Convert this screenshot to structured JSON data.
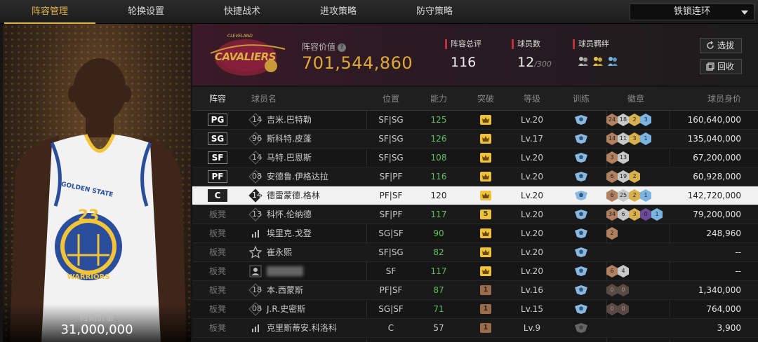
{
  "tabs": [
    "阵容管理",
    "轮换设置",
    "快捷战术",
    "进攻策略",
    "防守策略"
  ],
  "active_tab": 0,
  "dropdown": {
    "selected": "铁锁连环"
  },
  "player_panel": {
    "value_label": "时刻价值",
    "value": "31,000,000",
    "jersey_team": "GOLDEN STATE",
    "jersey_number": "23",
    "jersey_bottom": "WARRIORS"
  },
  "team": {
    "logo_text": "CAVALIERS",
    "logo_small": "CLEVELAND",
    "lineup_label": "阵容价值",
    "lineup_value": "701,544,860",
    "total_label": "阵容总评",
    "total_value": "116",
    "players_label": "球员数",
    "players_value": "12",
    "players_max": "/300",
    "bond_label": "球员羁绊"
  },
  "buttons": {
    "select": "选拔",
    "recycle": "回收"
  },
  "columns": [
    "阵容",
    "球员名",
    "位置",
    "能力",
    "突破",
    "等级",
    "训练",
    "徽章",
    "球员身价"
  ],
  "rows": [
    {
      "slot": "PG",
      "num": "14",
      "name": "吉米.巴特勒",
      "pos": "SF|SG",
      "ability": "125",
      "green": true,
      "brk": "",
      "brk_style": "gold",
      "lv": "Lv.20",
      "badges": [
        [
          "24",
          "bronze"
        ],
        [
          "18",
          "silver"
        ],
        [
          "2",
          "gold"
        ],
        [
          "3",
          "blue"
        ]
      ],
      "worth": "160,640,000"
    },
    {
      "slot": "SG",
      "num": "96",
      "name": "斯科特.皮蓬",
      "pos": "SF|SG",
      "ability": "126",
      "green": true,
      "brk": "",
      "brk_style": "gold",
      "lv": "Lv.17",
      "badges": [
        [
          "14",
          "bronze"
        ],
        [
          "11",
          "silver"
        ],
        [
          "3",
          "gold"
        ],
        [
          "1",
          "blue"
        ]
      ],
      "worth": "135,040,000"
    },
    {
      "slot": "SF",
      "num": "14",
      "name": "马特.巴恩斯",
      "pos": "SF|SG",
      "ability": "108",
      "green": true,
      "brk": "",
      "brk_style": "gold",
      "lv": "Lv.20",
      "badges": [
        [
          "3",
          "bronze"
        ],
        [
          "13",
          "silver"
        ]
      ],
      "worth": "67,200,000"
    },
    {
      "slot": "PF",
      "num": "08",
      "name": "安德鲁.伊格达拉",
      "pos": "SF|PF",
      "ability": "116",
      "green": true,
      "brk": "",
      "brk_style": "gold",
      "lv": "Lv.20",
      "badges": [
        [
          "6",
          "bronze"
        ],
        [
          "19",
          "silver"
        ],
        [
          "2",
          "gold"
        ]
      ],
      "worth": "60,928,000"
    },
    {
      "slot": "C",
      "num": "14",
      "name": "德雷蒙德.格林",
      "pos": "PF|SF",
      "ability": "120",
      "green": false,
      "brk": "",
      "brk_style": "gold",
      "lv": "Lv.20",
      "badges": [
        [
          "6",
          "bronze"
        ],
        [
          "25",
          "silver"
        ],
        [
          "2",
          "gold"
        ],
        [
          "1",
          "blue"
        ]
      ],
      "worth": "142,720,000"
    },
    {
      "slot": "板凳",
      "num": "13",
      "name": "科怀.伦纳德",
      "pos": "SF|PF",
      "ability": "117",
      "green": true,
      "brk": "5",
      "brk_style": "gold",
      "lv": "Lv.20",
      "badges": [
        [
          "34",
          "bronze"
        ],
        [
          "6",
          "silver"
        ],
        [
          "3",
          "gold"
        ],
        [
          "0",
          "purple"
        ],
        [
          "1",
          "blue"
        ]
      ],
      "worth": "79,200,000"
    },
    {
      "slot": "板凳",
      "num": "",
      "name": "埃里克.戈登",
      "pos": "SG|SF",
      "ability": "90",
      "green": true,
      "brk": "",
      "brk_style": "gold",
      "lv": "Lv.20",
      "badges": [
        [
          "2",
          "bronze"
        ]
      ],
      "worth": "248,960"
    },
    {
      "slot": "板凳",
      "num": "",
      "name": "崔永熙",
      "pos": "SF|SG",
      "ability": "82",
      "green": true,
      "brk": "",
      "brk_style": "gold",
      "lv": "Lv.20",
      "badges": [],
      "worth": "--"
    },
    {
      "slot": "板凳",
      "num": "",
      "name": "",
      "pos": "SF",
      "ability": "117",
      "green": true,
      "brk": "",
      "brk_style": "gold",
      "lv": "Lv.20",
      "badges": [
        [
          "6",
          "bronze"
        ],
        [
          "4",
          "silver"
        ]
      ],
      "worth": "--"
    },
    {
      "slot": "板凳",
      "num": "18",
      "name": "本.西蒙斯",
      "pos": "PF|SF",
      "ability": "87",
      "green": true,
      "brk": "1",
      "brk_style": "brown",
      "lv": "Lv.16",
      "badges": [
        [
          "0",
          "dark"
        ],
        [
          "0",
          "dark"
        ]
      ],
      "worth": "1,340,000"
    },
    {
      "slot": "板凳",
      "num": "08",
      "name": "J.R.史密斯",
      "pos": "SG|SF",
      "ability": "71",
      "green": true,
      "brk": "1",
      "brk_style": "brown",
      "lv": "Lv.15",
      "badges": [
        [
          "0",
          "dark"
        ],
        [
          "0",
          "dark"
        ]
      ],
      "worth": "764,000"
    },
    {
      "slot": "板凳",
      "num": "",
      "name": "克里斯蒂安.科洛科",
      "pos": "C",
      "ability": "57",
      "green": false,
      "brk": "1",
      "brk_style": "brown",
      "lv": "Lv.9",
      "badges": [],
      "worth": "3,900"
    }
  ]
}
